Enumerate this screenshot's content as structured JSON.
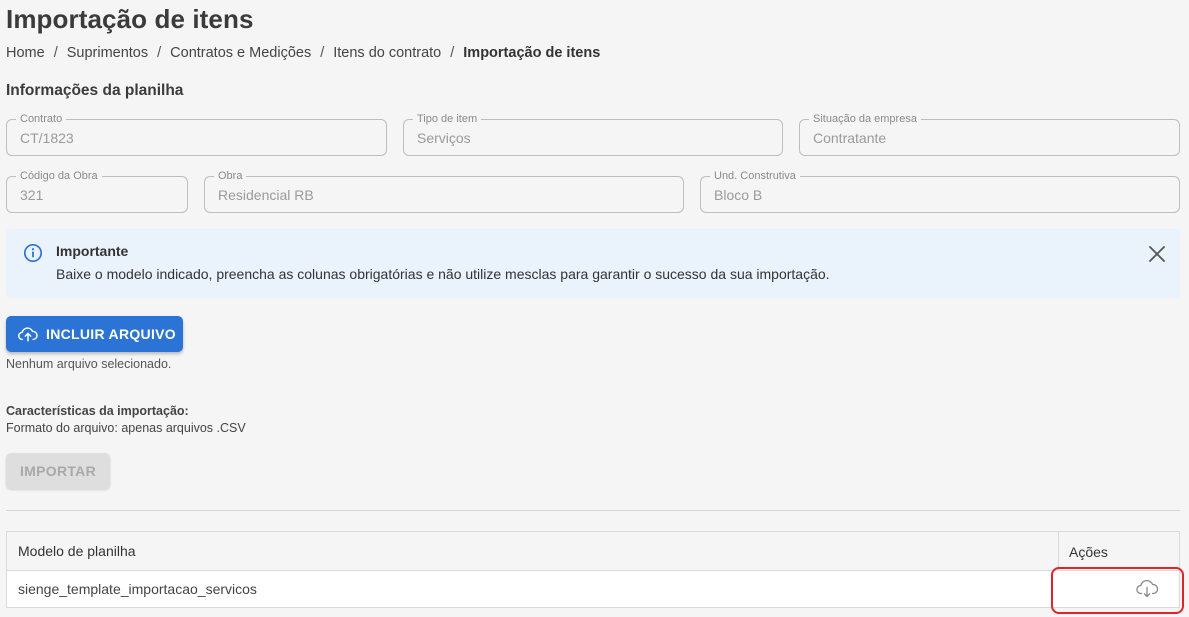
{
  "page": {
    "title": "Importação de itens"
  },
  "breadcrumb": [
    "Home",
    "Suprimentos",
    "Contratos e Medições",
    "Itens do contrato",
    "Importação de itens"
  ],
  "section": {
    "title": "Informações da planilha"
  },
  "fields": {
    "contrato": {
      "label": "Contrato",
      "value": "CT/1823"
    },
    "tipo_item": {
      "label": "Tipo de item",
      "value": "Serviços"
    },
    "situacao_empresa": {
      "label": "Situação da empresa",
      "value": "Contratante"
    },
    "codigo_obra": {
      "label": "Código da Obra",
      "value": "321"
    },
    "obra": {
      "label": "Obra",
      "value": "Residencial RB"
    },
    "und_construtiva": {
      "label": "Und. Construtiva",
      "value": "Bloco B"
    }
  },
  "alert": {
    "title": "Importante",
    "message": "Baixe o modelo indicado, preencha as colunas obrigatórias e não utilize mesclas para garantir o sucesso da sua importação.",
    "icon": "info-icon"
  },
  "upload": {
    "button_label": "INCLUIR ARQUIVO",
    "status": "Nenhum arquivo selecionado."
  },
  "characteristics": {
    "title": "Características da importação:",
    "format": "Formato do arquivo: apenas arquivos .CSV"
  },
  "import_button": {
    "label": "IMPORTAR",
    "disabled": true
  },
  "table": {
    "headers": {
      "model": "Modelo de planilha",
      "actions": "Ações"
    },
    "rows": [
      {
        "model": "sienge_template_importacao_servicos",
        "action_icon": "cloud-download-icon"
      }
    ]
  },
  "colors": {
    "primary": "#2b74d6",
    "alert_bg": "#eaf2fb",
    "highlight": "#e0242a"
  }
}
